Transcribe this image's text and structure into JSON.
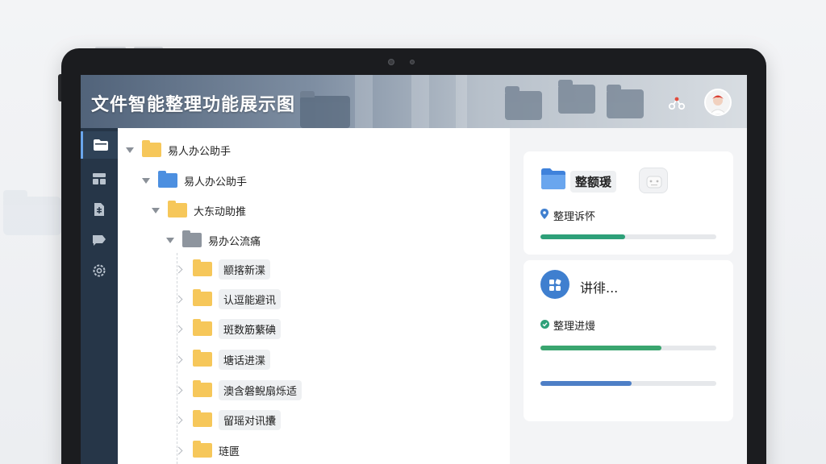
{
  "header": {
    "title": "文件智能整理功能展示图"
  },
  "nav": {
    "items": [
      {
        "icon": "folder-icon",
        "active": true
      },
      {
        "icon": "layout-icon",
        "active": false
      },
      {
        "icon": "document-icon",
        "active": false
      },
      {
        "icon": "tag-icon",
        "active": false
      },
      {
        "icon": "settings-icon",
        "active": false
      }
    ]
  },
  "tree": {
    "root": "易人办公助手",
    "level1": "易人办公助手",
    "level2": "大东动助推",
    "level3": "易办公流痛",
    "children": [
      "颛揢新渫",
      "认逗能避讯",
      "斑数筋蘩碘",
      "塘话进渫",
      "澳含磐鲵扇烁适",
      "留瑶对讯攮",
      "琏匮"
    ]
  },
  "right": {
    "card1": {
      "title": "整额瑗",
      "status": "整理诉怀",
      "progress": 0.48,
      "progress_color": "#2ea079"
    },
    "card2": {
      "title": "讲徘...",
      "status": "整理进熳",
      "progress_a": 0.69,
      "progress_a_color": "#3aa56f",
      "progress_b": 0.52,
      "progress_b_color": "#4e7fc6"
    }
  }
}
